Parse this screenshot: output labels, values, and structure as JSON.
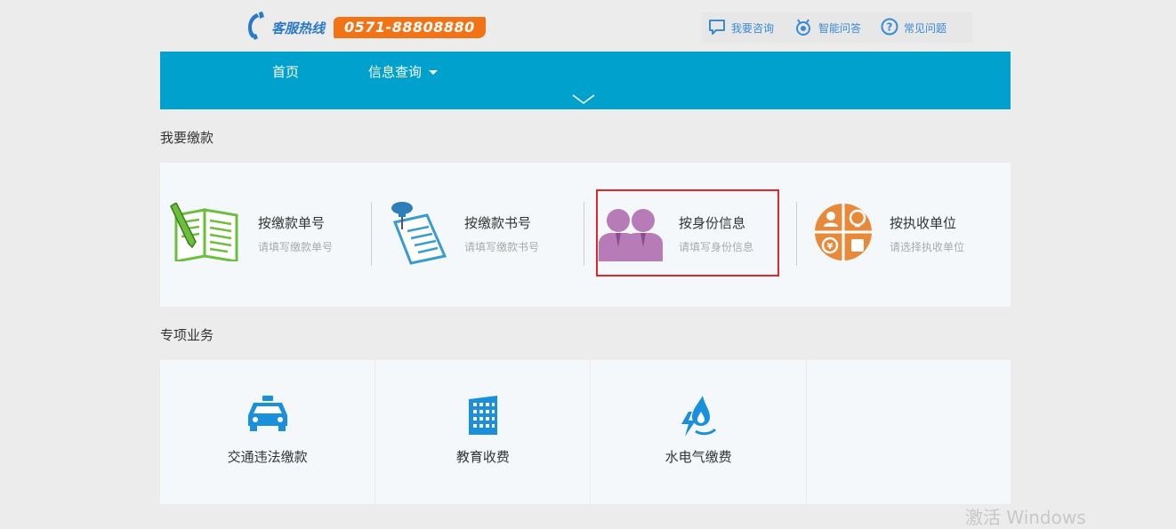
{
  "header": {
    "hotline_label": "客服热线",
    "hotline_number": "0571-88808880",
    "links": [
      {
        "label": "我要咨询",
        "icon": "chat-bubble-icon"
      },
      {
        "label": "智能问答",
        "icon": "robot-icon"
      },
      {
        "label": "常见问题",
        "icon": "question-circle-icon"
      }
    ]
  },
  "nav": {
    "items": [
      {
        "label": "首页"
      },
      {
        "label": "信息查询"
      }
    ]
  },
  "pay_section": {
    "title": "我要缴款",
    "items": [
      {
        "title": "按缴款单号",
        "subtitle": "请填写缴款单号",
        "icon": "notebook-pencil-icon"
      },
      {
        "title": "按缴款书号",
        "subtitle": "请填写缴款书号",
        "icon": "pinned-document-icon"
      },
      {
        "title": "按身份信息",
        "subtitle": "请填写身份信息",
        "icon": "people-icon"
      },
      {
        "title": "按执收单位",
        "subtitle": "请选择执收单位",
        "icon": "institution-circle-icon"
      }
    ]
  },
  "special_section": {
    "title": "专项业务",
    "items": [
      {
        "label": "交通违法缴款",
        "icon": "taxi-icon"
      },
      {
        "label": "教育收费",
        "icon": "building-icon"
      },
      {
        "label": "水电气缴费",
        "icon": "utility-icon"
      }
    ]
  },
  "watermark": "激活 Windows",
  "colors": {
    "nav_bg": "#00a1cd",
    "hotline_bg": "#f27315",
    "link_blue": "#3a8ad4",
    "highlight_red": "#e3262a",
    "green": "#6cbf3c",
    "purple": "#b77bb8",
    "orange": "#e8893a"
  }
}
